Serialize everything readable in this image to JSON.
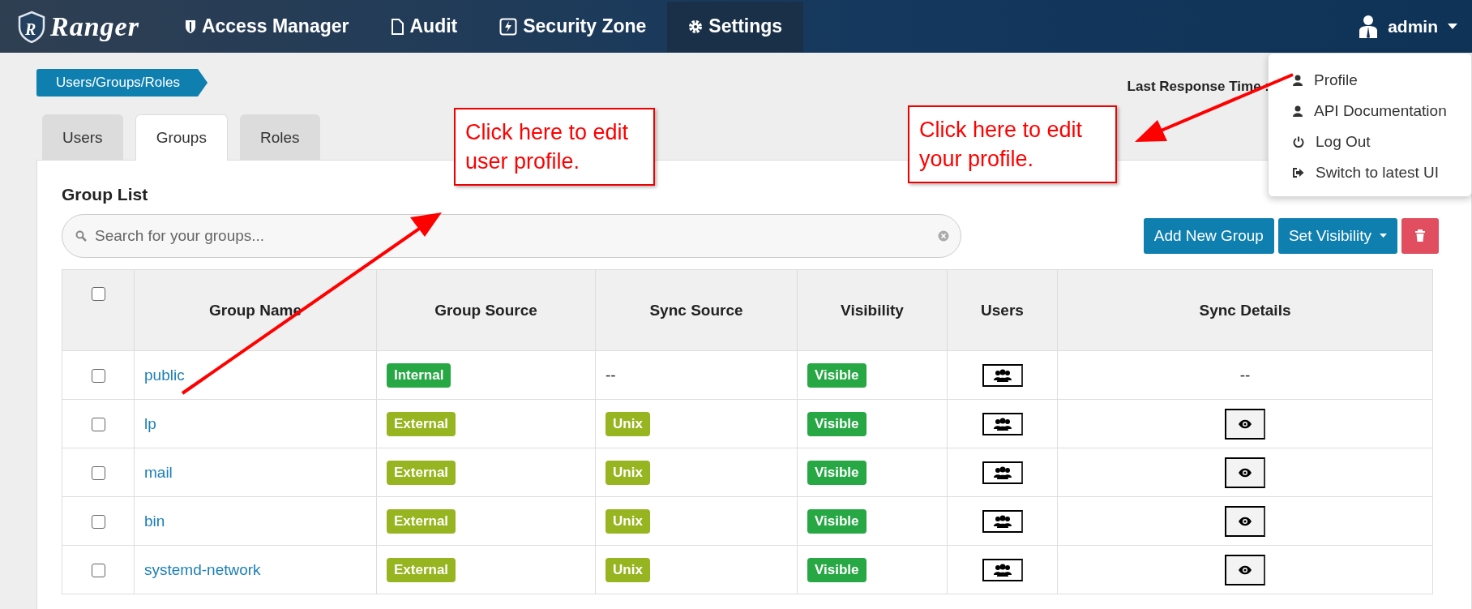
{
  "navbar": {
    "logo_letter": "R",
    "brand": "Ranger",
    "items": [
      {
        "label": "Access Manager",
        "selected": false
      },
      {
        "label": "Audit",
        "selected": false
      },
      {
        "label": "Security Zone",
        "selected": false
      },
      {
        "label": "Settings",
        "selected": true
      }
    ],
    "user": "admin"
  },
  "user_menu": {
    "items": [
      "Profile",
      "API Documentation",
      "Log Out",
      "Switch to latest UI"
    ]
  },
  "breadcrumb": "Users/Groups/Roles",
  "last_response_label": "Last Response Time :",
  "tabs": [
    {
      "label": "Users",
      "selected": false
    },
    {
      "label": "Groups",
      "selected": true
    },
    {
      "label": "Roles",
      "selected": false
    }
  ],
  "group_list": {
    "title": "Group List",
    "search": {
      "placeholder": "Search for your groups..."
    },
    "buttons": {
      "add": "Add New Group",
      "visibility": "Set Visibility"
    },
    "table": {
      "select_all_checked": false,
      "columns": [
        "Group Name",
        "Group Source",
        "Sync Source",
        "Visibility",
        "Users",
        "Sync Details"
      ],
      "rows": [
        {
          "checked": false,
          "name": "public",
          "source": {
            "text": "Internal",
            "kind": "internal"
          },
          "sync_source": {
            "kind": "text",
            "text": "--"
          },
          "visibility": "Visible",
          "sync_details": {
            "kind": "text",
            "text": "--"
          }
        },
        {
          "checked": false,
          "name": "lp",
          "source": {
            "text": "External",
            "kind": "external"
          },
          "sync_source": {
            "kind": "badge",
            "text": "Unix"
          },
          "visibility": "Visible",
          "sync_details": {
            "kind": "button"
          }
        },
        {
          "checked": false,
          "name": "mail",
          "source": {
            "text": "External",
            "kind": "external"
          },
          "sync_source": {
            "kind": "badge",
            "text": "Unix"
          },
          "visibility": "Visible",
          "sync_details": {
            "kind": "button"
          }
        },
        {
          "checked": false,
          "name": "bin",
          "source": {
            "text": "External",
            "kind": "external"
          },
          "sync_source": {
            "kind": "badge",
            "text": "Unix"
          },
          "visibility": "Visible",
          "sync_details": {
            "kind": "button"
          }
        },
        {
          "checked": false,
          "name": "systemd-network",
          "source": {
            "text": "External",
            "kind": "external"
          },
          "sync_source": {
            "kind": "badge",
            "text": "Unix"
          },
          "visibility": "Visible",
          "sync_details": {
            "kind": "button"
          }
        }
      ]
    }
  },
  "callouts": [
    "Click here to edit user profile.",
    "Click here to edit your profile."
  ]
}
